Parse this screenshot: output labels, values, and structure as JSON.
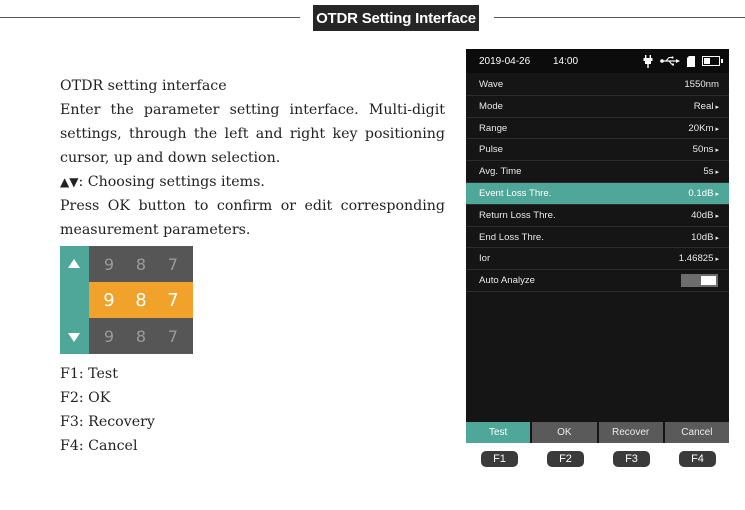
{
  "header": {
    "title": "OTDR Setting Interface"
  },
  "description": {
    "title": "OTDR setting interface",
    "paragraph1": "Enter the parameter setting interface. Multi-digit settings, through the left and right key positioning cursor, up and down selection.",
    "arrows_symbol": "▲▼",
    "arrows_text": ": Choosing settings items.",
    "paragraph2": "Press OK button to confirm or edit corresponding measurement parameters."
  },
  "digit_widget": {
    "top_row": [
      "9",
      "8",
      "7"
    ],
    "middle_row": [
      "9",
      "8",
      "7"
    ],
    "bottom_row": [
      "9",
      "8",
      "7"
    ],
    "highlight_color": "#f0a22a",
    "side_color": "#4fa79a",
    "icons": [
      "up-arrow-icon",
      "down-arrow-icon"
    ]
  },
  "function_keys": {
    "f1": "F1: Test",
    "f2": "F2: OK",
    "f3": "F3: Recovery",
    "f4": "F4: Cancel"
  },
  "device": {
    "status": {
      "date": "2019-04-26",
      "time": "14:00",
      "icons": [
        "plug-icon",
        "usb-icon",
        "sd-card-icon",
        "battery-icon"
      ]
    },
    "settings": [
      {
        "label": "Wave",
        "value": "1550nm",
        "caret": false
      },
      {
        "label": "Mode",
        "value": "Real",
        "caret": true
      },
      {
        "label": "Range",
        "value": "20Km",
        "caret": true
      },
      {
        "label": "Pulse",
        "value": "50ns",
        "caret": true
      },
      {
        "label": "Avg. Time",
        "value": "5s",
        "caret": true
      },
      {
        "label": "Event Loss Thre.",
        "value": "0.1dB",
        "caret": true
      },
      {
        "label": "Return Loss Thre.",
        "value": "40dB",
        "caret": true
      },
      {
        "label": "End Loss Thre.",
        "value": "10dB",
        "caret": true
      },
      {
        "label": "Ior",
        "value": "1.46825",
        "caret": true
      },
      {
        "label": "Auto Analyze",
        "value": "",
        "caret": false
      }
    ],
    "caret_symbol": "▸",
    "selected_index": 5,
    "accent_color": "#4fa79a",
    "buttons": [
      "Test",
      "OK",
      "Recover",
      "Cancel"
    ],
    "fkeys": [
      "F1",
      "F2",
      "F3",
      "F4"
    ]
  }
}
